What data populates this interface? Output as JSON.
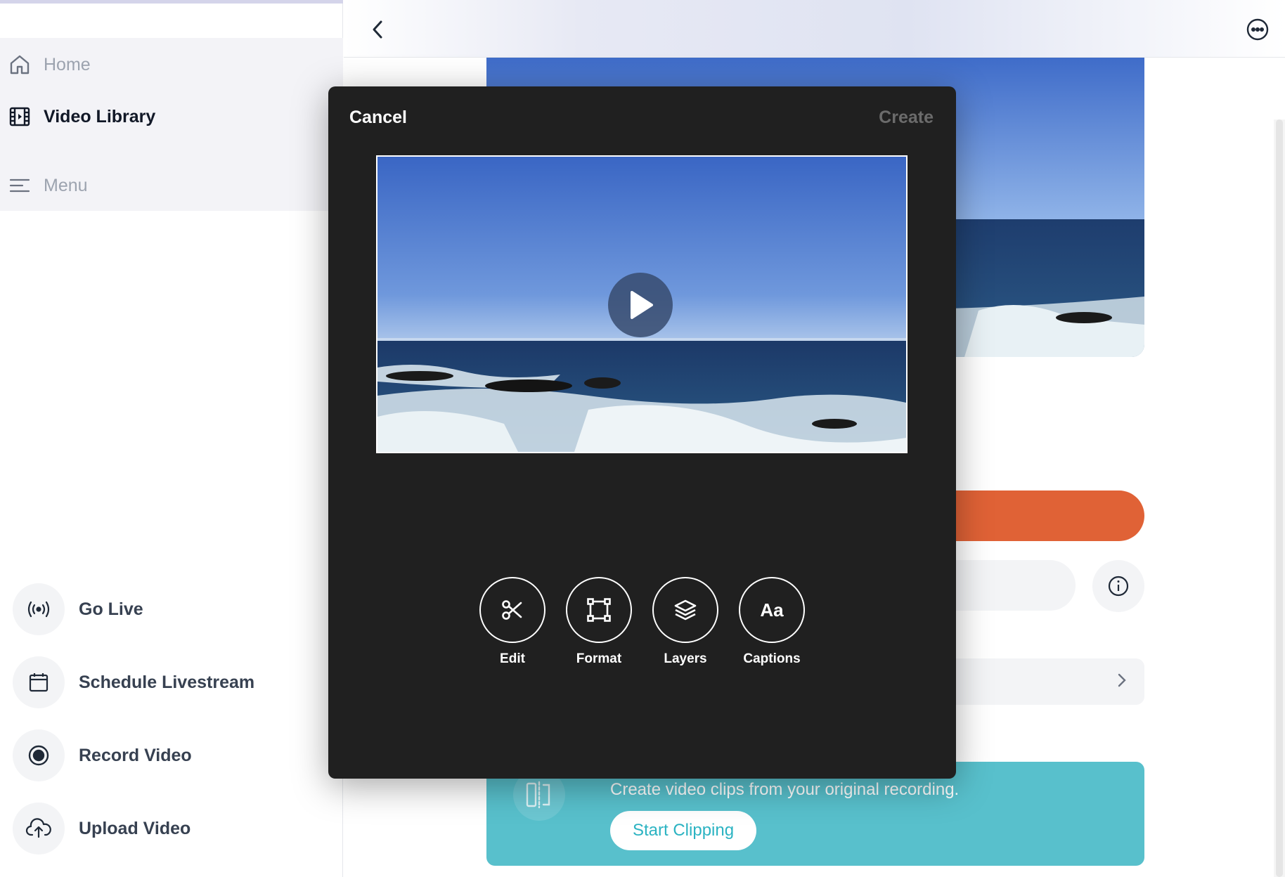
{
  "sidebar": {
    "nav": [
      {
        "label": "Home",
        "icon": "home-icon",
        "active": false
      },
      {
        "label": "Video Library",
        "icon": "film-icon",
        "active": true
      },
      {
        "label": "Menu",
        "icon": "menu-icon",
        "active": false
      }
    ],
    "actions": [
      {
        "label": "Go Live",
        "icon": "broadcast-icon"
      },
      {
        "label": "Schedule Livestream",
        "icon": "calendar-icon"
      },
      {
        "label": "Record Video",
        "icon": "record-icon"
      },
      {
        "label": "Upload Video",
        "icon": "cloud-upload-icon"
      }
    ]
  },
  "modal": {
    "cancel_label": "Cancel",
    "create_label": "Create",
    "tools": [
      {
        "label": "Edit",
        "icon": "scissors-icon"
      },
      {
        "label": "Format",
        "icon": "crop-frame-icon"
      },
      {
        "label": "Layers",
        "icon": "layers-icon"
      },
      {
        "label": "Captions",
        "icon": "captions-icon",
        "glyph": "Aa"
      }
    ]
  },
  "clip_banner": {
    "text": "Create video clips from your original recording.",
    "button_label": "Start Clipping"
  },
  "colors": {
    "accent_orange": "#e06236",
    "banner_teal": "#58c0cc",
    "modal_bg": "#202020"
  }
}
